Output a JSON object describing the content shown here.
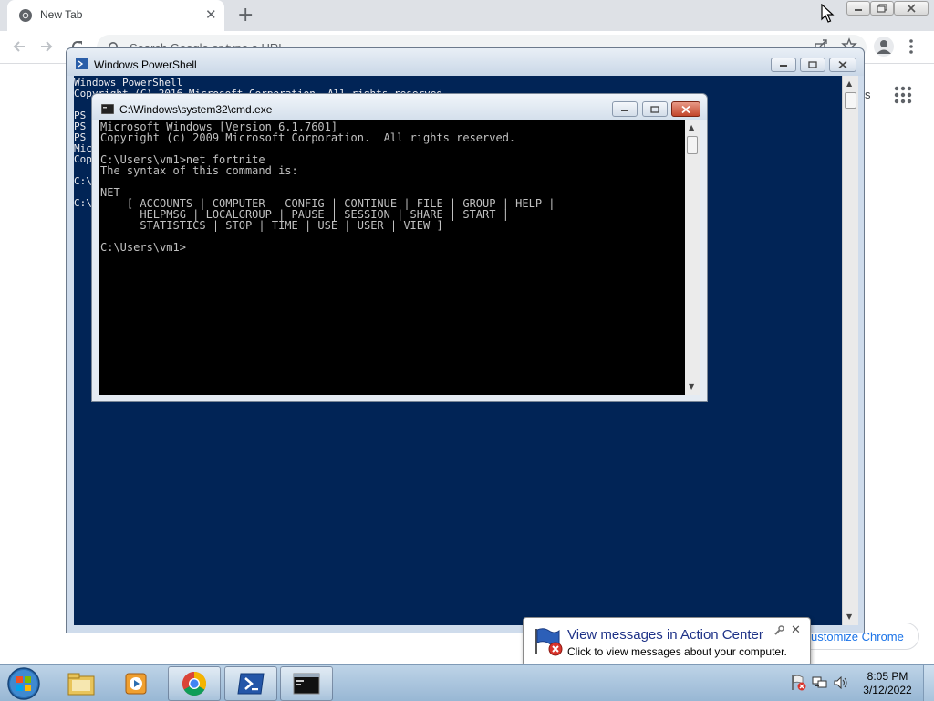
{
  "chrome": {
    "tab_title": "New Tab",
    "tab_close": "✕",
    "new_tab": "+",
    "omnibox_placeholder": "Search Google or type a URL",
    "ntp_images_link_tail": "s",
    "customize_button": "ustomize Chrome"
  },
  "powershell": {
    "title": "Windows PowerShell",
    "lines": [
      "Windows PowerShell",
      "Copyright (C) 2016 Microsoft Corporation. All rights reserved.",
      "",
      "PS",
      "PS",
      "PS",
      "Mic",
      "Cop",
      "",
      "C:\\",
      "",
      "C:\\"
    ]
  },
  "cmd": {
    "title": "C:\\Windows\\system32\\cmd.exe",
    "lines": [
      "Microsoft Windows [Version 6.1.7601]",
      "Copyright (c) 2009 Microsoft Corporation.  All rights reserved.",
      "",
      "C:\\Users\\vm1>net fortnite",
      "The syntax of this command is:",
      "",
      "NET",
      "    [ ACCOUNTS | COMPUTER | CONFIG | CONTINUE | FILE | GROUP | HELP |",
      "      HELPMSG | LOCALGROUP | PAUSE | SESSION | SHARE | START |",
      "      STATISTICS | STOP | TIME | USE | USER | VIEW ]",
      "",
      "C:\\Users\\vm1>"
    ]
  },
  "balloon": {
    "title": "View messages in Action Center",
    "text": "Click to view messages about your computer.",
    "close": "✕"
  },
  "taskbar": {
    "time": "8:05 PM",
    "date": "3/12/2022"
  },
  "colors": {
    "powershell_bg": "#012456",
    "cmd_bg": "#000000",
    "balloon_title": "#1e3287"
  }
}
